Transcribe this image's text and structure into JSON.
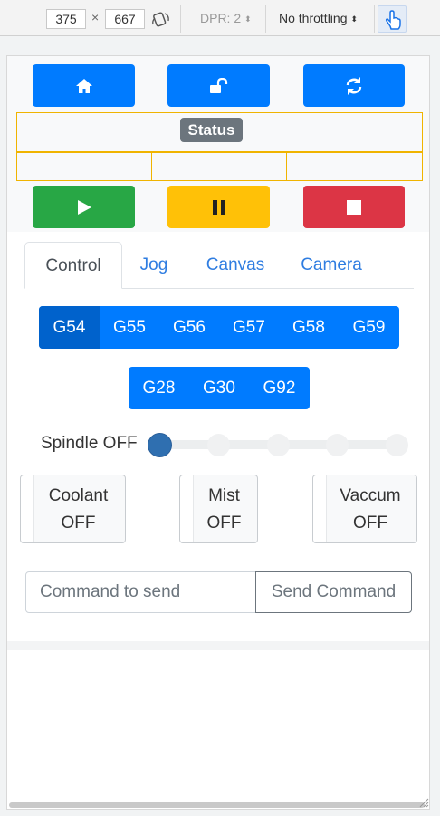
{
  "devtools": {
    "width": "375",
    "height": "667",
    "times": "×",
    "dpr": "DPR: 2",
    "throttling": "No throttling",
    "updown": "⬍",
    "icons": [
      "rotate-icon",
      "touch-pointer-icon",
      "chevron-updown-icon"
    ]
  },
  "top_buttons": [
    "home-icon",
    "unlock-icon",
    "refresh-icon"
  ],
  "status": {
    "label": "Status"
  },
  "run_buttons": [
    "play-icon",
    "pause-icon",
    "stop-icon"
  ],
  "colors": {
    "primary": "#007bff",
    "success": "#28a745",
    "warning": "#ffc107",
    "danger": "#dc3545",
    "status_badge": "#6c757d",
    "status_border": "#f0b400"
  },
  "tabs": [
    "Control",
    "Jog",
    "Canvas",
    "Camera"
  ],
  "active_tab": "Control",
  "wcs_group": [
    "G54",
    "G55",
    "G56",
    "G57",
    "G58",
    "G59"
  ],
  "wcs_active": "G54",
  "home_group": [
    "G28",
    "G30",
    "G92"
  ],
  "spindle": {
    "label": "Spindle OFF",
    "level": 0,
    "steps": 5
  },
  "toggles": [
    {
      "line1": "Coolant",
      "line2": "OFF"
    },
    {
      "line1": "Mist",
      "line2": "OFF"
    },
    {
      "line1": "Vaccum",
      "line2": "OFF"
    }
  ],
  "command": {
    "placeholder": "Command to send",
    "button": "Send Command"
  }
}
